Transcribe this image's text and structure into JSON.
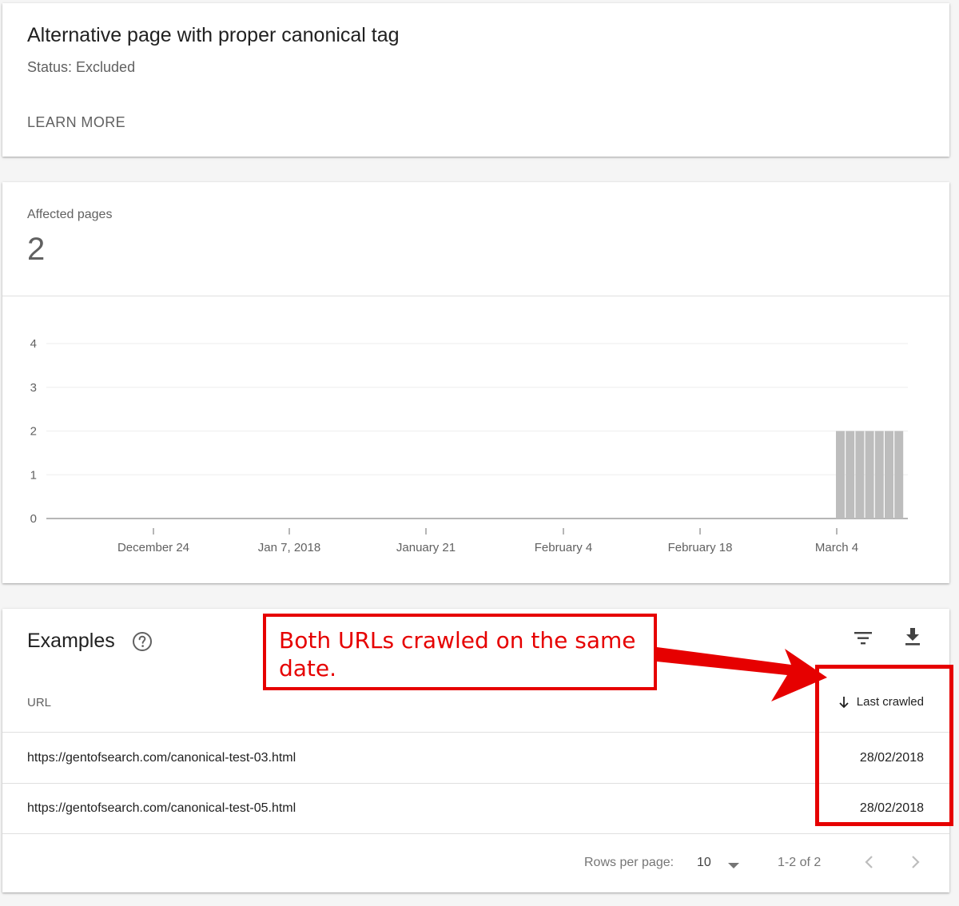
{
  "issue": {
    "title": "Alternative page with proper canonical tag",
    "status": "Status: Excluded",
    "learn_more": "LEARN MORE"
  },
  "affected": {
    "label": "Affected pages",
    "value": "2"
  },
  "chart_data": {
    "type": "bar",
    "title": "",
    "xlabel": "",
    "ylabel": "",
    "ylim": [
      0,
      4
    ],
    "yticks": [
      0,
      1,
      2,
      3,
      4
    ],
    "xtick_labels": [
      "December 24",
      "Jan 7, 2018",
      "January 21",
      "February 4",
      "February 18",
      "March 4"
    ],
    "grid": true,
    "bar_color": "#bdbdbd",
    "series": [
      {
        "values": [
          2,
          2,
          2,
          2,
          2,
          2,
          2
        ]
      }
    ]
  },
  "examples": {
    "title": "Examples",
    "help_icon": "help-circle-icon",
    "filter_icon": "filter-icon",
    "download_icon": "download-icon",
    "columns": {
      "url": "URL",
      "last_crawled": "Last crawled"
    },
    "sort_icon": "arrow-down-icon",
    "rows": [
      {
        "url": "https://gentofsearch.com/canonical-test-03.html",
        "date": "28/02/2018"
      },
      {
        "url": "https://gentofsearch.com/canonical-test-05.html",
        "date": "28/02/2018"
      }
    ],
    "footer": {
      "rows_per_page_label": "Rows per page:",
      "rows_per_page_value": "10",
      "range": "1-2 of 2"
    }
  },
  "annotation": {
    "text": "Both URLs crawled on the same date.",
    "color": "#e60000"
  }
}
